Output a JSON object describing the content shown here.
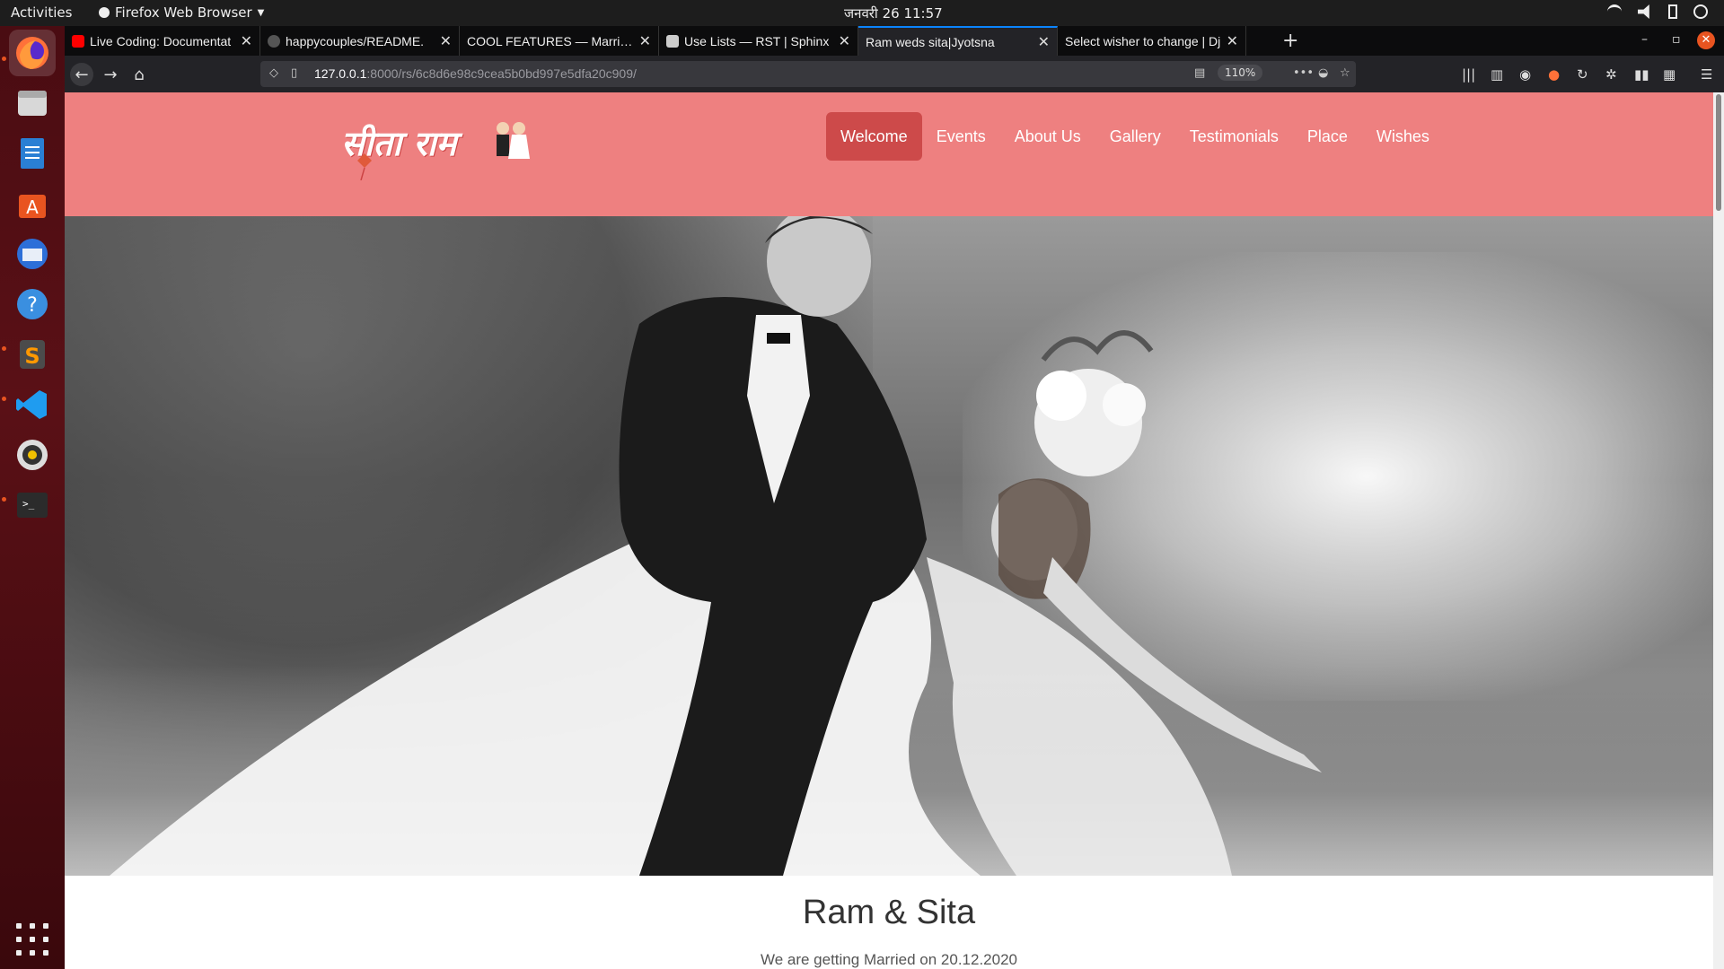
{
  "system": {
    "activities": "Activities",
    "app_name": "Firefox Web Browser",
    "clock": "जनवरी 26  11:57"
  },
  "tabs": [
    {
      "title": "Live Coding: Documentat",
      "favicon_color": "#ff0000"
    },
    {
      "title": "happycouples/README.",
      "favicon_color": "#555555"
    },
    {
      "title": "COOL FEATURES — Marriag",
      "favicon_color": "#1a1a1a"
    },
    {
      "title": "Use Lists — RST | Sphinx",
      "favicon_color": "#cccccc"
    },
    {
      "title": "Ram weds sita|Jyotsna",
      "favicon_color": "#232327"
    },
    {
      "title": "Select wisher to change | Dj",
      "favicon_color": "#0c0c0d"
    }
  ],
  "address": {
    "host": "127.0.0.1",
    "path": ":8000/rs/6c8d6e98c9cea5b0bd997e5dfa20c909/",
    "zoom": "110%"
  },
  "site": {
    "logo_text": "सीता राम",
    "nav": [
      "Welcome",
      "Events",
      "About Us",
      "Gallery",
      "Testimonials",
      "Place",
      "Wishes"
    ],
    "active_nav": "Welcome",
    "heading": "Ram & Sita",
    "subheading": "We are getting Married on 20.12.2020",
    "header_color": "#ee8080",
    "active_color": "#cd4a4a"
  }
}
